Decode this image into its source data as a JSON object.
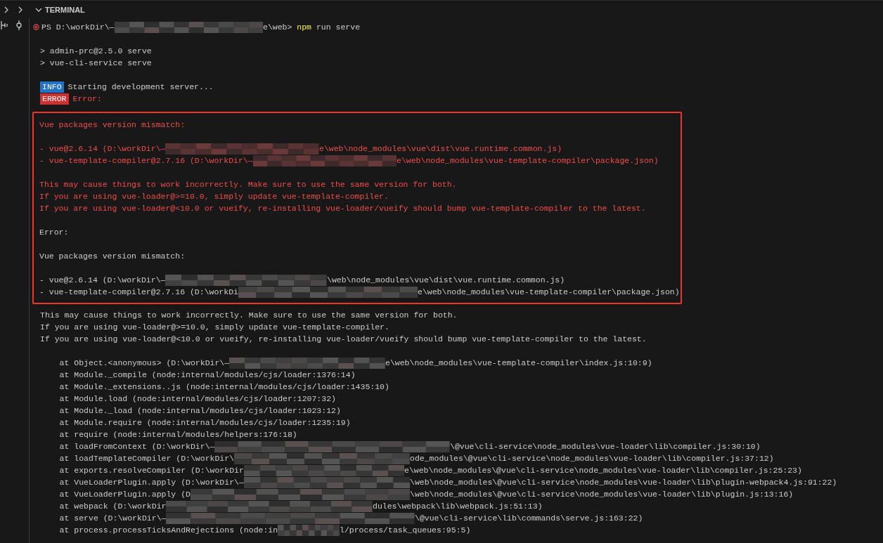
{
  "panel": {
    "title": "TERMINAL",
    "expanded": true
  },
  "terminal": {
    "prompt": {
      "failed": true,
      "before": "PS D:\\workDir\\—",
      "after": "e\\web> ",
      "command": "npm",
      "args": " run serve"
    },
    "lines_before": [
      {
        "kind": "blank"
      },
      {
        "kind": "text",
        "error": false,
        "text": "> admin-prc@2.5.0 serve"
      },
      {
        "kind": "text",
        "error": false,
        "text": "> vue-cli-service serve"
      },
      {
        "kind": "blank"
      },
      {
        "kind": "badge",
        "error": false,
        "badge": "INFO",
        "text": "Starting development server..."
      },
      {
        "kind": "badge",
        "error": true,
        "badge": "ERROR",
        "text": "Error:"
      }
    ],
    "highlight": {
      "lines": [
        {
          "kind": "text",
          "error": true,
          "text": "Vue packages version mismatch:"
        },
        {
          "kind": "blank"
        },
        {
          "kind": "redacted",
          "error": true,
          "before": "- vue@2.6.14 (D:\\workDir\\—",
          "after": "e\\web\\node_modules\\vue\\dist\\vue.runtime.common.js)"
        },
        {
          "kind": "redacted",
          "error": true,
          "before": "- vue-template-compiler@2.7.16 (D:\\workDir\\—",
          "after": "e\\web\\node_modules\\vue-template-compiler\\package.json)"
        },
        {
          "kind": "blank"
        },
        {
          "kind": "text",
          "error": true,
          "text": "This may cause things to work incorrectly. Make sure to use the same version for both."
        },
        {
          "kind": "text",
          "error": true,
          "text": "If you are using vue-loader@>=10.0, simply update vue-template-compiler."
        },
        {
          "kind": "text",
          "error": true,
          "text": "If you are using vue-loader@<10.0 or vueify, re-installing vue-loader/vueify should bump vue-template-compiler to the latest."
        },
        {
          "kind": "blank"
        },
        {
          "kind": "text",
          "error": false,
          "text": "Error:"
        },
        {
          "kind": "blank"
        },
        {
          "kind": "text",
          "error": false,
          "text": "Vue packages version mismatch:"
        },
        {
          "kind": "blank"
        },
        {
          "kind": "redacted",
          "error": false,
          "before": "- vue@2.6.14 (D:\\workDir\\—",
          "after": "\\web\\node_modules\\vue\\dist\\vue.runtime.common.js)"
        },
        {
          "kind": "redacted",
          "error": false,
          "before": "- vue-template-compiler@2.7.16 (D:\\workDi",
          "after": "e\\web\\node_modules\\vue-template-compiler\\package.json)"
        }
      ]
    },
    "lines_after": [
      {
        "kind": "text",
        "error": false,
        "text": "This may cause things to work incorrectly. Make sure to use the same version for both."
      },
      {
        "kind": "text",
        "error": false,
        "text": "If you are using vue-loader@>=10.0, simply update vue-template-compiler."
      },
      {
        "kind": "text",
        "error": false,
        "text": "If you are using vue-loader@<10.0 or vueify, re-installing vue-loader/vueify should bump vue-template-compiler to the latest."
      },
      {
        "kind": "blank"
      },
      {
        "kind": "redacted",
        "error": false,
        "before": "    at Object.<anonymous> (D:\\workDir\\—",
        "after": "e\\web\\node_modules\\vue-template-compiler\\index.js:10:9)"
      },
      {
        "kind": "text",
        "error": false,
        "text": "    at Module._compile (node:internal/modules/cjs/loader:1376:14)"
      },
      {
        "kind": "text",
        "error": false,
        "text": "    at Module._extensions..js (node:internal/modules/cjs/loader:1435:10)"
      },
      {
        "kind": "text",
        "error": false,
        "text": "    at Module.load (node:internal/modules/cjs/loader:1207:32)"
      },
      {
        "kind": "text",
        "error": false,
        "text": "    at Module._load (node:internal/modules/cjs/loader:1023:12)"
      },
      {
        "kind": "text",
        "error": false,
        "text": "    at Module.require (node:internal/modules/cjs/loader:1235:19)"
      },
      {
        "kind": "text",
        "error": false,
        "text": "    at require (node:internal/modules/helpers:176:18)"
      },
      {
        "kind": "redacted",
        "error": false,
        "before": "    at loadFromContext (D:\\workDir\\—",
        "after": "\\@vue\\cli-service\\node_modules\\vue-loader\\lib\\compiler.js:30:10)"
      },
      {
        "kind": "redacted",
        "error": false,
        "before": "    at loadTemplateCompiler (D:\\workDir\\",
        "after": "ode_modules\\@vue\\cli-service\\node_modules\\vue-loader\\lib\\compiler.js:37:12)"
      },
      {
        "kind": "redacted",
        "error": false,
        "before": "    at exports.resolveCompiler (D:\\workDir",
        "after": "e\\web\\node_modules\\@vue\\cli-service\\node_modules\\vue-loader\\lib\\compiler.js:25:23)"
      },
      {
        "kind": "redacted",
        "error": false,
        "before": "    at VueLoaderPlugin.apply (D:\\workDir\\—",
        "after": "\\web\\node_modules\\@vue\\cli-service\\node_modules\\vue-loader\\lib\\plugin-webpack4.js:91:22)"
      },
      {
        "kind": "redacted",
        "error": false,
        "before": "    at VueLoaderPlugin.apply (D",
        "after": "\\web\\node_modules\\@vue\\cli-service\\node_modules\\vue-loader\\lib\\plugin.js:13:16)"
      },
      {
        "kind": "redacted",
        "error": false,
        "before": "    at webpack (D:\\workDir",
        "after": "dules\\webpack\\lib\\webpack.js:51:13)"
      },
      {
        "kind": "redacted",
        "error": false,
        "before": "    at serve (D:\\workDir\\—",
        "after": "\\@vue\\cli-service\\lib\\commands\\serve.js:163:22)"
      },
      {
        "kind": "redacted",
        "error": false,
        "before": "    at process.processTicksAndRejections (node:in",
        "after": "l/process/task_queues:95:5)"
      }
    ]
  }
}
